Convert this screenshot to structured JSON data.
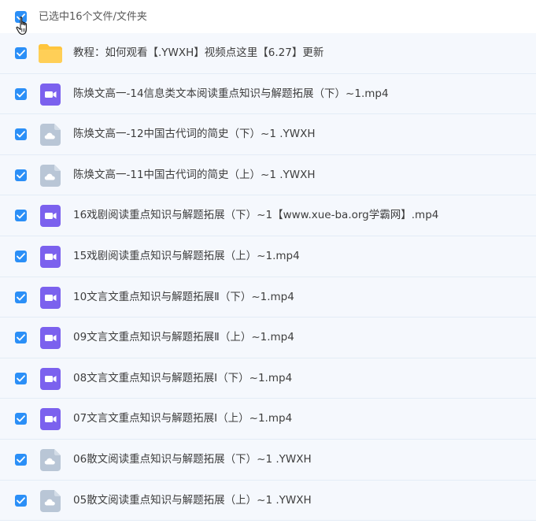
{
  "header": {
    "selection_text": "已选中16个文件/文件夹"
  },
  "colors": {
    "accent": "#2b8ff7",
    "row_bg": "#f5f8fd",
    "video_icon": "#7b61ee",
    "cloud_icon": "#b9c6d6",
    "folder_icon": "#ffc53d"
  },
  "files": [
    {
      "name": "教程：如何观看【.YWXH】视频点这里【6.27】更新",
      "icon": "folder-icon",
      "checked": true
    },
    {
      "name": "陈焕文高一-14信息类文本阅读重点知识与解题拓展（下）~1.mp4",
      "icon": "video-file-icon",
      "checked": true
    },
    {
      "name": "陈焕文高一-12中国古代词的简史（下）~1 .YWXH",
      "icon": "cloud-file-icon",
      "checked": true
    },
    {
      "name": "陈焕文高一-11中国古代词的简史（上）~1 .YWXH",
      "icon": "cloud-file-icon",
      "checked": true
    },
    {
      "name": "16戏剧阅读重点知识与解题拓展（下）~1【www.xue-ba.org学霸网】.mp4",
      "icon": "video-file-icon",
      "checked": true
    },
    {
      "name": "15戏剧阅读重点知识与解题拓展（上）~1.mp4",
      "icon": "video-file-icon",
      "checked": true
    },
    {
      "name": "10文言文重点知识与解题拓展Ⅱ（下）~1.mp4",
      "icon": "video-file-icon",
      "checked": true
    },
    {
      "name": "09文言文重点知识与解题拓展Ⅱ（上）~1.mp4",
      "icon": "video-file-icon",
      "checked": true
    },
    {
      "name": "08文言文重点知识与解题拓展Ⅰ（下）~1.mp4",
      "icon": "video-file-icon",
      "checked": true
    },
    {
      "name": "07文言文重点知识与解题拓展Ⅰ（上）~1.mp4",
      "icon": "video-file-icon",
      "checked": true
    },
    {
      "name": "06散文阅读重点知识与解题拓展（下）~1 .YWXH",
      "icon": "cloud-file-icon",
      "checked": true
    },
    {
      "name": "05散文阅读重点知识与解题拓展（上）~1 .YWXH",
      "icon": "cloud-file-icon",
      "checked": true
    }
  ]
}
